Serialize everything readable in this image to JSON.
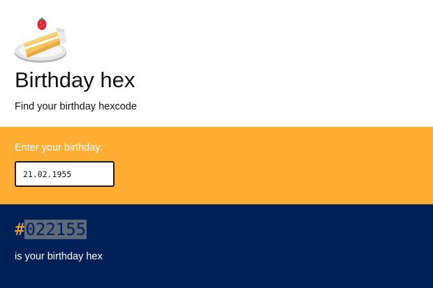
{
  "header": {
    "icon": "birthday-cake-icon",
    "title": "Birthday hex",
    "subtitle": "Find your birthday hexcode"
  },
  "input_section": {
    "label": "Enter your birthday:",
    "birthday_value": "21.02.1955"
  },
  "result_section": {
    "hash": "#",
    "hex_value": "022155",
    "caption": "is your birthday hex"
  },
  "colors": {
    "accent_orange": "#ffad33",
    "navy": "#002157",
    "hex_highlight": "#5e6a7a"
  }
}
